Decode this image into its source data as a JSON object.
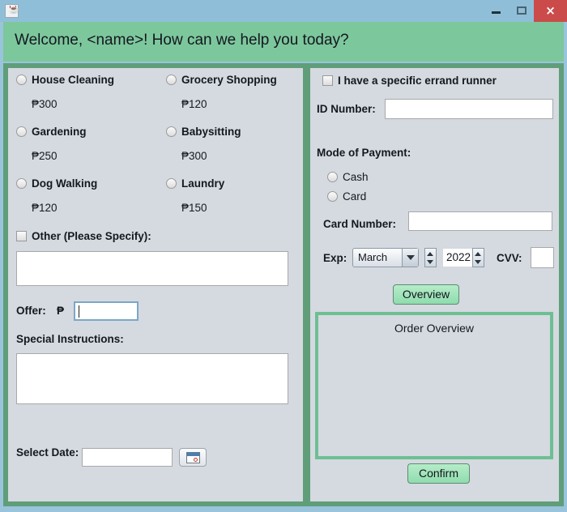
{
  "window": {
    "minimize_label": "minimize",
    "maximize_label": "maximize",
    "close_label": "×",
    "app_icon": "java-icon"
  },
  "banner": {
    "text": "Welcome, <name>! How can we help you today?",
    "color": "#7dc79c"
  },
  "theme": {
    "accent_green": "#5f9e79",
    "panel_bg": "#d5d9e0",
    "titlebar": "#8fbfd8",
    "close_red": "#cb4b4b"
  },
  "services": {
    "currency": "₱",
    "items": [
      {
        "label": "House Cleaning",
        "price": "₱300",
        "selected": false
      },
      {
        "label": "Grocery Shopping",
        "price": "₱120",
        "selected": false
      },
      {
        "label": "Gardening",
        "price": "₱250",
        "selected": false
      },
      {
        "label": "Babysitting",
        "price": "₱300",
        "selected": false
      },
      {
        "label": "Dog Walking",
        "price": "₱120",
        "selected": false
      },
      {
        "label": "Laundry",
        "price": "₱150",
        "selected": false
      }
    ],
    "other_label": "Other (Please Specify):",
    "other_checked": false,
    "other_value": "",
    "other_placeholder": ""
  },
  "offer": {
    "label": "Offer:",
    "currency": "₱",
    "value": "",
    "focused": true
  },
  "special_instructions": {
    "label": "Special Instructions:",
    "value": ""
  },
  "select_date": {
    "label": "Select Date:",
    "value": "",
    "button_icon": "calendar-icon"
  },
  "runner": {
    "checkbox_label": "I have a specific errand runner",
    "checked": false,
    "id_label": "ID Number:",
    "id_value": ""
  },
  "payment": {
    "heading": "Mode of Payment:",
    "options": [
      {
        "label": "Cash",
        "selected": false
      },
      {
        "label": "Card",
        "selected": false
      }
    ],
    "card_number_label": "Card Number:",
    "card_number_value": "",
    "exp_label": "Exp:",
    "exp_month": "March",
    "exp_year": "2022",
    "cvv_label": "CVV:",
    "cvv_value": ""
  },
  "actions": {
    "overview_button": "Overview",
    "confirm_button": "Confirm"
  },
  "overview_panel": {
    "title": "Order Overview",
    "body": ""
  }
}
